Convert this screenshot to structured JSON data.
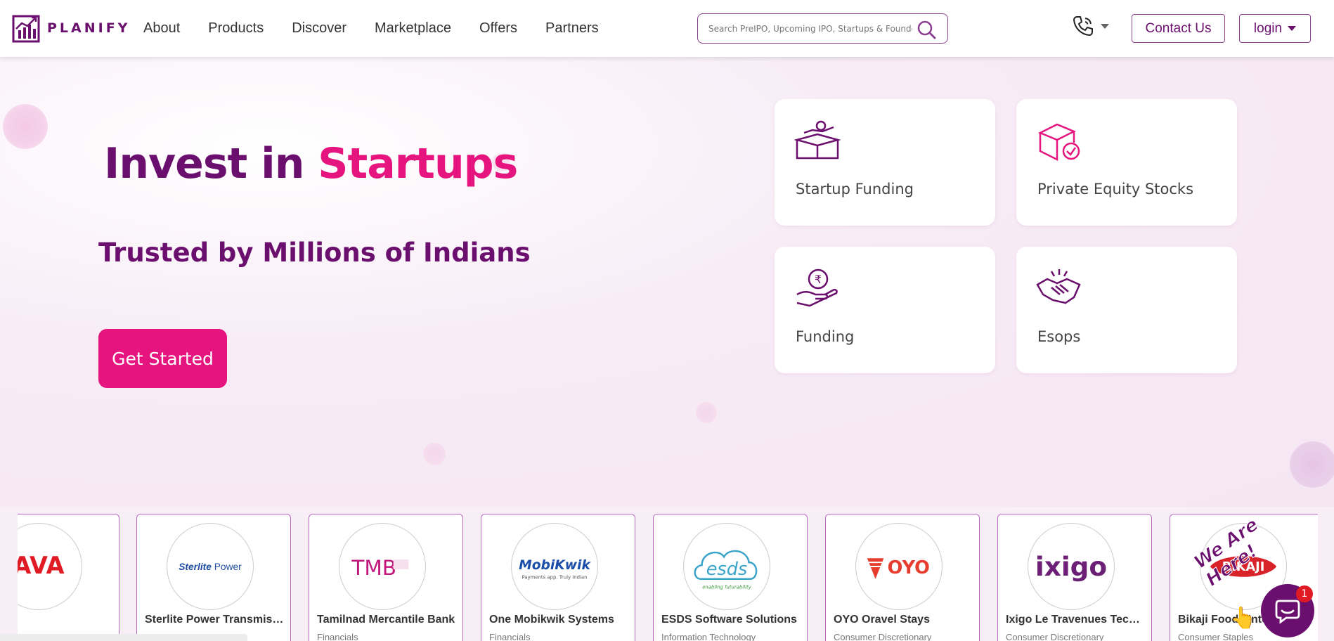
{
  "header": {
    "logo_text": "PLANIFY",
    "nav": [
      "About",
      "Products",
      "Discover",
      "Marketplace",
      "Offers",
      "Partners"
    ],
    "search_placeholder": "Search PreIPO, Upcoming IPO, Startups & Founders",
    "contact_label": "Contact Us",
    "login_label": "login"
  },
  "hero": {
    "title_main": "Invest in ",
    "title_accent": "Startups",
    "subtitle": "Trusted by Millions of Indians",
    "cta_label": "Get Started"
  },
  "cards": [
    {
      "label": "Startup Funding",
      "icon": "box-coin-icon"
    },
    {
      "label": "Private Equity Stocks",
      "icon": "box-check-icon"
    },
    {
      "label": "Funding",
      "icon": "rupee-hand-icon"
    },
    {
      "label": "Esops",
      "icon": "handshake-icon"
    }
  ],
  "companies": [
    {
      "name": "",
      "sector": "",
      "logo_text": "AVA"
    },
    {
      "name": "Sterlite Power Transmission",
      "sector": "",
      "logo_text": "Sterlite Power"
    },
    {
      "name": "Tamilnad Mercantile Bank",
      "sector": "Financials",
      "logo_text": "TMB"
    },
    {
      "name": "One Mobikwik Systems",
      "sector": "Financials",
      "logo_text": "MobiKwik"
    },
    {
      "name": "ESDS Software Solutions",
      "sector": "Information Technology",
      "logo_text": "esds"
    },
    {
      "name": "OYO Oravel Stays",
      "sector": "Consumer Discretionary",
      "logo_text": "OYO"
    },
    {
      "name": "Ixigo Le Travenues Technol...",
      "sector": "Consumer Discretionary",
      "logo_text": "ixigo"
    },
    {
      "name": "Bikaji Foods Intern...",
      "sector": "Consumer Staples",
      "logo_text": "BIKAJI"
    }
  ],
  "chat": {
    "badge_count": "1",
    "teaser": "We Are Here!"
  },
  "colors": {
    "brand_purple": "#6b0f6e",
    "brand_pink": "#e6147f"
  }
}
